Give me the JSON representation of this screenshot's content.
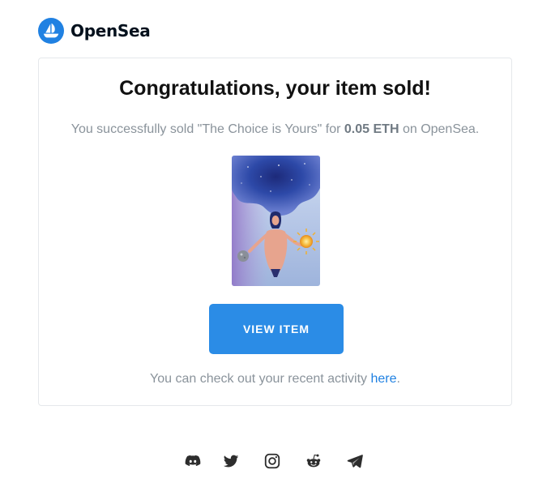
{
  "brand": {
    "name": "OpenSea",
    "logo_icon": "opensea-logo-icon",
    "accent_color": "#2081e2"
  },
  "email": {
    "title": "Congratulations, your item sold!",
    "message_prefix": "You successfully sold \"The Choice is Yours\" for ",
    "message_amount": "0.05 ETH",
    "message_suffix": " on OpenSea.",
    "nft_image_icon": "nft-artwork-image",
    "button_label": "VIEW ITEM",
    "button_color": "#2b8ce6",
    "activity_prefix": "You can check out your recent activity ",
    "activity_link": "here",
    "activity_suffix": "."
  },
  "footer": {
    "social_icons": [
      "discord-icon",
      "twitter-icon",
      "instagram-icon",
      "reddit-icon",
      "telegram-icon"
    ]
  }
}
